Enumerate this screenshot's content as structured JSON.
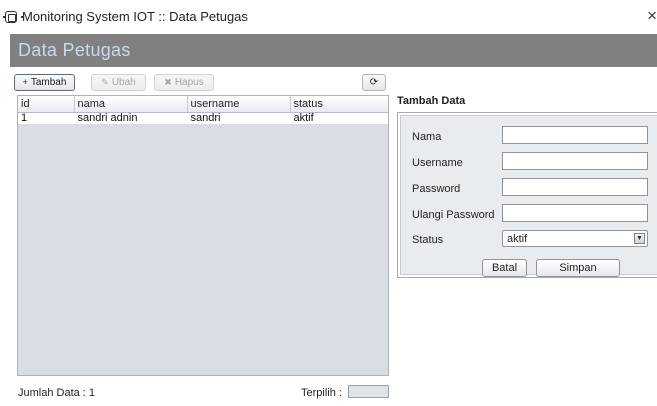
{
  "window": {
    "title": "Monitoring System IOT :: Data Petugas",
    "close_glyph": "×"
  },
  "header": {
    "title": "Data Petugas"
  },
  "toolbar": {
    "add_label": "Tambah",
    "add_icon": "+",
    "edit_label": "Ubah",
    "edit_icon": "✎",
    "delete_label": "Hapus",
    "delete_icon": "✖",
    "refresh_icon": "⟳"
  },
  "table": {
    "columns": [
      "id",
      "nama",
      "username",
      "status"
    ],
    "rows": [
      [
        "1",
        "sandri adnin",
        "sandri",
        "aktif"
      ]
    ]
  },
  "status_bar": {
    "count_label": "Jumlah Data : 1",
    "selected_label": "Terpilih :"
  },
  "form": {
    "title": "Tambah Data",
    "name_label": "Nama",
    "username_label": "Username",
    "password_label": "Password",
    "confirm_password_label": "Ulangi Password",
    "status_label": "Status",
    "status_value": "aktif",
    "cancel_label": "Batal",
    "save_label": "Simpan"
  }
}
